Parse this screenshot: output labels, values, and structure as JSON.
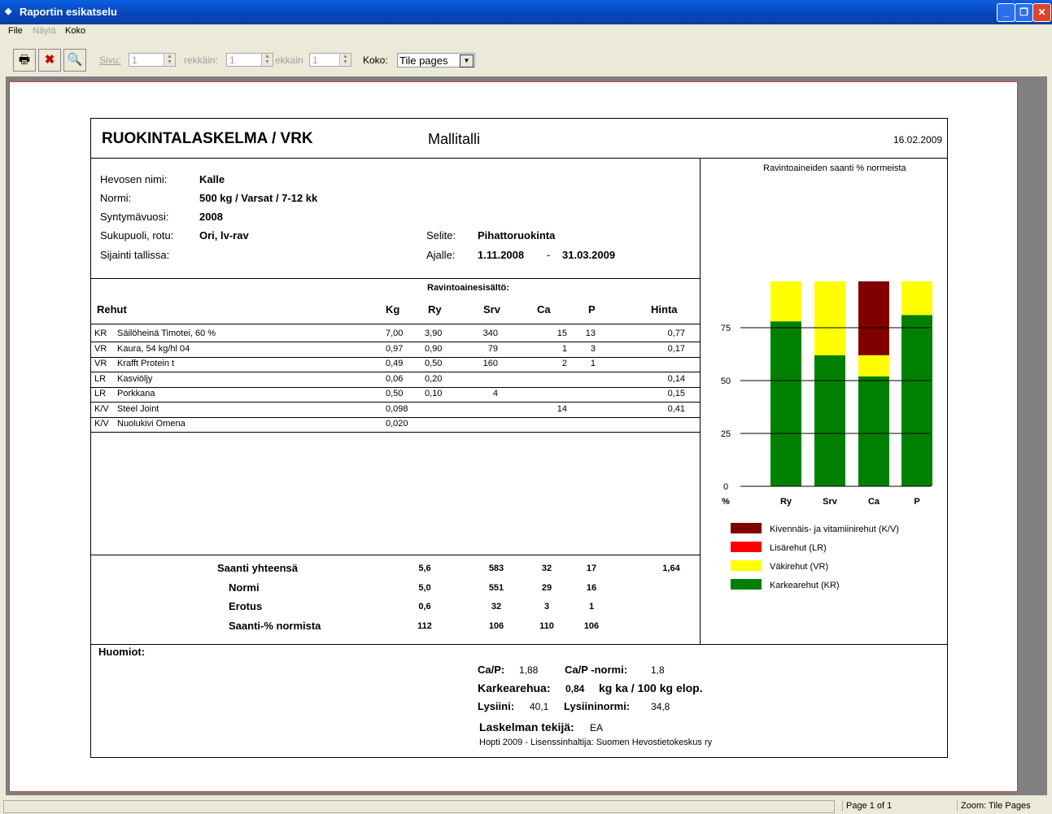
{
  "window": {
    "title": "Raportin esikatselu"
  },
  "menu": {
    "file": "File",
    "nayta": "Näytä",
    "koko": "Koko"
  },
  "toolbar": {
    "sivu_label": "Sivu:",
    "sivu_value": "1",
    "rekkain_label": "rekkäin:",
    "rekkain_value": "1",
    "ekkain_label": "ekkain",
    "ekkain_value": "1",
    "koko_label": "Koko:",
    "koko_value": "Tile pages"
  },
  "report": {
    "title": "RUOKINTALASKELMA / VRK",
    "stable": "Mallitalli",
    "date": "16.02.2009",
    "info": {
      "name_label": "Hevosen nimi:",
      "name": "Kalle",
      "norm_label": "Normi:",
      "norm": "500 kg / Varsat / 7-12 kk",
      "born_label": "Syntymävuosi:",
      "born": "2008",
      "sex_label": "Sukupuoli, rotu:",
      "sex": "Ori, lv-rav",
      "loc_label": "Sijainti tallissa:",
      "selite_label": "Selite:",
      "selite": "Pihattoruokinta",
      "ajalle_label": "Ajalle:",
      "ajalle_from": "1.11.2008",
      "ajalle_dash": "-",
      "ajalle_to": "31.03.2009"
    },
    "table": {
      "super_header": "Ravintoainesisältö:",
      "headers": [
        "Rehut",
        "Kg",
        "Ry",
        "Srv",
        "Ca",
        "P",
        "Hinta"
      ],
      "rows": [
        {
          "type": "KR",
          "name": "Säilöheinä Timotei, 60 %",
          "kg": "7,00",
          "ry": "3,90",
          "srv": "340",
          "ca": "15",
          "p": "13",
          "hinta": "0,77"
        },
        {
          "type": "VR",
          "name": "Kaura, 54 kg/hl 04",
          "kg": "0,97",
          "ry": "0,90",
          "srv": "79",
          "ca": "1",
          "p": "3",
          "hinta": "0,17"
        },
        {
          "type": "VR",
          "name": "Krafft Protein t",
          "kg": "0,49",
          "ry": "0,50",
          "srv": "160",
          "ca": "2",
          "p": "1",
          "hinta": ""
        },
        {
          "type": "LR",
          "name": "Kasviöljy",
          "kg": "0,06",
          "ry": "0,20",
          "srv": "",
          "ca": "",
          "p": "",
          "hinta": "0,14"
        },
        {
          "type": "LR",
          "name": "Porkkana",
          "kg": "0,50",
          "ry": "0,10",
          "srv": "4",
          "ca": "",
          "p": "",
          "hinta": "0,15"
        },
        {
          "type": "K/V",
          "name": "Steel Joint",
          "kg": "0,098",
          "ry": "",
          "srv": "",
          "ca": "14",
          "p": "",
          "hinta": "0,41"
        },
        {
          "type": "K/V",
          "name": "Nuolukivi Omena",
          "kg": "0,020",
          "ry": "",
          "srv": "",
          "ca": "",
          "p": "",
          "hinta": ""
        }
      ]
    },
    "summary": [
      {
        "label": "Saanti yhteensä",
        "ry": "5,6",
        "srv": "583",
        "ca": "32",
        "p": "17",
        "hinta": "1,64"
      },
      {
        "label": "Normi",
        "ry": "5,0",
        "srv": "551",
        "ca": "29",
        "p": "16",
        "hinta": ""
      },
      {
        "label": "Erotus",
        "ry": "0,6",
        "srv": "32",
        "ca": "3",
        "p": "1",
        "hinta": ""
      },
      {
        "label": "Saanti-% normista",
        "ry": "112",
        "srv": "106",
        "ca": "110",
        "p": "106",
        "hinta": ""
      }
    ],
    "notes": {
      "huomiot": "Huomiot:",
      "cap_label": "Ca/P:",
      "cap": "1,88",
      "capnorm_label": "Ca/P -normi:",
      "capnorm": "1,8",
      "karkea_label": "Karkearehua:",
      "karkea": "0,84",
      "karkea_unit": "kg ka / 100 kg elop.",
      "lysiini_label": "Lysiini:",
      "lysiini": "40,1",
      "lysnorm_label": "Lysiininormi:",
      "lysnorm": "34,8",
      "tekija_label": "Laskelman tekijä:",
      "tekija": "EA",
      "footer": "Hopti 2009 - Lisenssinhaltija: Suomen Hevostietokeskus ry"
    }
  },
  "chart_data": {
    "type": "bar",
    "stacked": true,
    "title": "Ravintoaineiden saanti % normeista",
    "categories": [
      "Ry",
      "Srv",
      "Ca",
      "P"
    ],
    "ylabel": "%",
    "yticks": [
      0,
      25,
      50,
      75,
      100
    ],
    "ylim": [
      0,
      112
    ],
    "series": [
      {
        "name": "Karkearehut (KR)",
        "color": "#008000",
        "values": [
          78,
          62,
          52,
          81
        ]
      },
      {
        "name": "Väkirehut (VR)",
        "color": "#ffff00",
        "values": [
          28,
          43,
          10,
          25
        ]
      },
      {
        "name": "Lisärehut (LR)",
        "color": "#ff0000",
        "values": [
          6,
          1,
          0,
          0
        ]
      },
      {
        "name": "Kivennäis- ja vitamiinirehut (K/V)",
        "color": "#800000",
        "values": [
          0,
          0,
          48,
          0
        ]
      }
    ],
    "legend": "bottom"
  },
  "status": {
    "page": "Page 1 of 1",
    "zoom": "Zoom: Tile Pages"
  }
}
